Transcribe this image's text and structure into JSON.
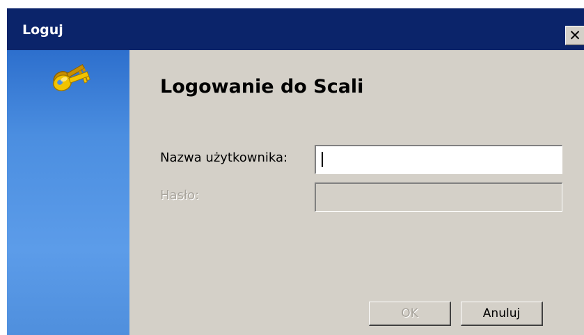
{
  "window": {
    "title": "Loguj",
    "close_label": "✕"
  },
  "side_panel": {
    "icon": "key-icon"
  },
  "content": {
    "title": "Logowanie do Scali"
  },
  "form": {
    "username_label": "Nazwa użytkownika:",
    "username_value": "",
    "password_label": "Hasło:",
    "password_value": ""
  },
  "buttons": {
    "ok_label": "OK",
    "cancel_label": "Anuluj"
  },
  "colors": {
    "titlebar": "#0b246a",
    "dialog_bg": "#d4d0c8",
    "side_panel": "#4b8ee0",
    "key": "#f2c300"
  }
}
